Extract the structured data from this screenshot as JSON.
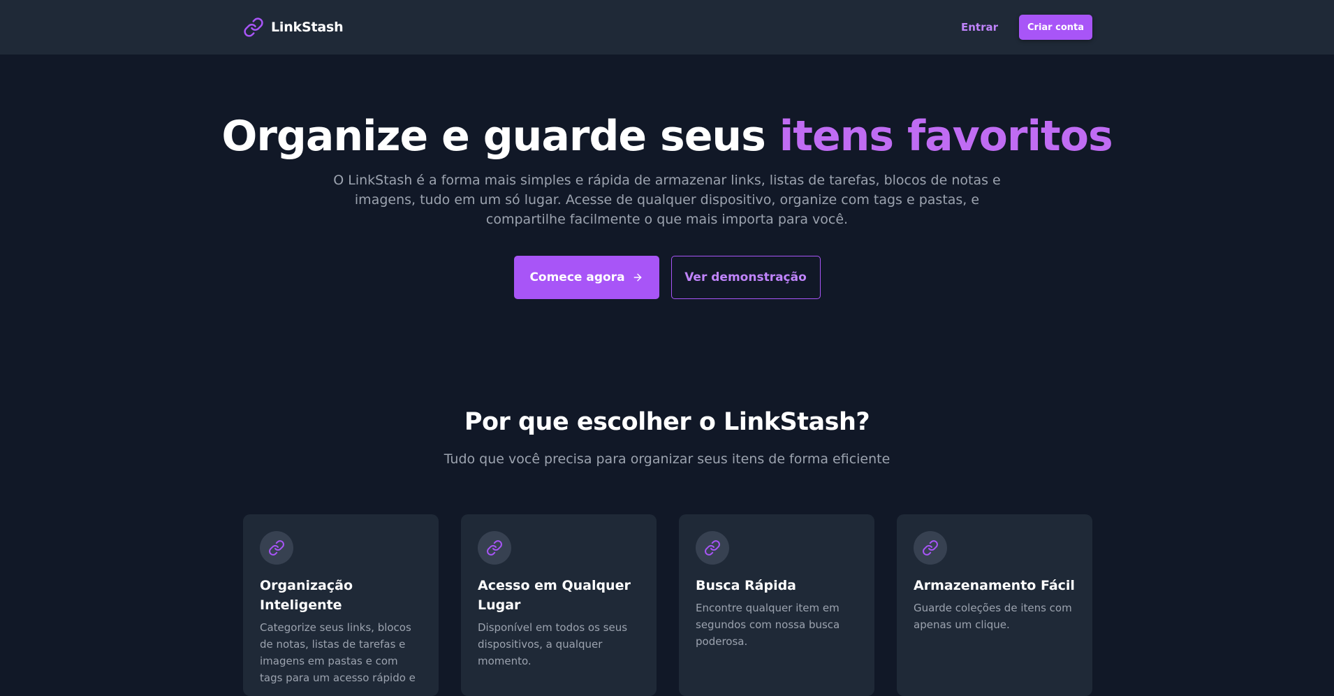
{
  "nav": {
    "brand": "LinkStash",
    "login_label": "Entrar",
    "signup_label": "Criar conta",
    "brand_icon": "link-icon"
  },
  "hero": {
    "title_main": "Organize e guarde seus ",
    "title_accent": "itens favoritos",
    "description": "O LinkStash é a forma mais simples e rápida de armazenar links, listas de tarefas, blocos de notas e imagens, tudo em um só lugar. Acesse de qualquer dispositivo, organize com tags e pastas, e compartilhe facilmente o que mais importa para você.",
    "primary_cta": "Comece agora",
    "secondary_cta": "Ver demonstração"
  },
  "features": {
    "title": "Por que escolher o LinkStash?",
    "subtitle": "Tudo que você precisa para organizar seus itens de forma eficiente",
    "cards": [
      {
        "icon": "link-icon",
        "title": "Organização Inteligente",
        "text": "Categorize seus links, blocos de notas, listas de tarefas e imagens em pastas e com tags para um acesso rápido e"
      },
      {
        "icon": "link-icon",
        "title": "Acesso em Qualquer Lugar",
        "text": "Disponível em todos os seus dispositivos, a qualquer momento."
      },
      {
        "icon": "link-icon",
        "title": "Busca Rápida",
        "text": "Encontre qualquer item em segundos com nossa busca poderosa."
      },
      {
        "icon": "link-icon",
        "title": "Armazenamento Fácil",
        "text": "Guarde coleções de itens com apenas um clique."
      }
    ]
  },
  "colors": {
    "background": "#111827",
    "surface": "#1f2937",
    "accent": "#a855f7",
    "accent_text": "#c084fc",
    "muted_text": "#9ca3af"
  }
}
